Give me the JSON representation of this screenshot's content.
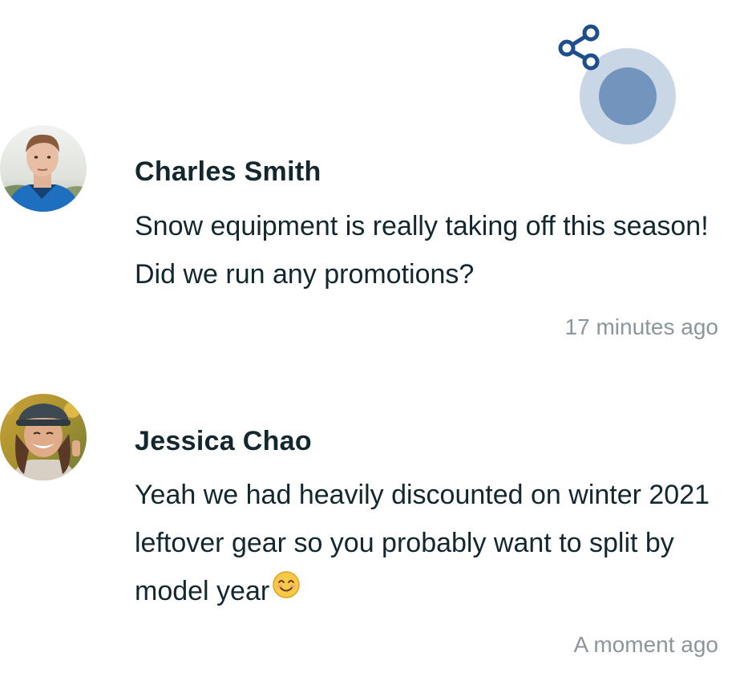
{
  "share": {
    "icon": "share-icon",
    "color": "#1f4e8c"
  },
  "comments": [
    {
      "author": "Charles Smith",
      "avatar_icon": "avatar-photo",
      "text": "Snow equipment is really taking off this season! Did we run any promotions?",
      "time": "17 minutes ago"
    },
    {
      "author": "Jessica Chao",
      "avatar_icon": "avatar-photo",
      "text": "Yeah we had heavily discounted on winter 2021 leftover gear so you probably want to split by model year",
      "emoji": "smiling-face-emoji",
      "time": "A moment ago"
    }
  ],
  "colors": {
    "text": "#13272f",
    "muted": "#8b969c",
    "accent": "#1f4e8c",
    "focus_ring": "#c9d6e5",
    "focus_dot": "#7394bd"
  }
}
